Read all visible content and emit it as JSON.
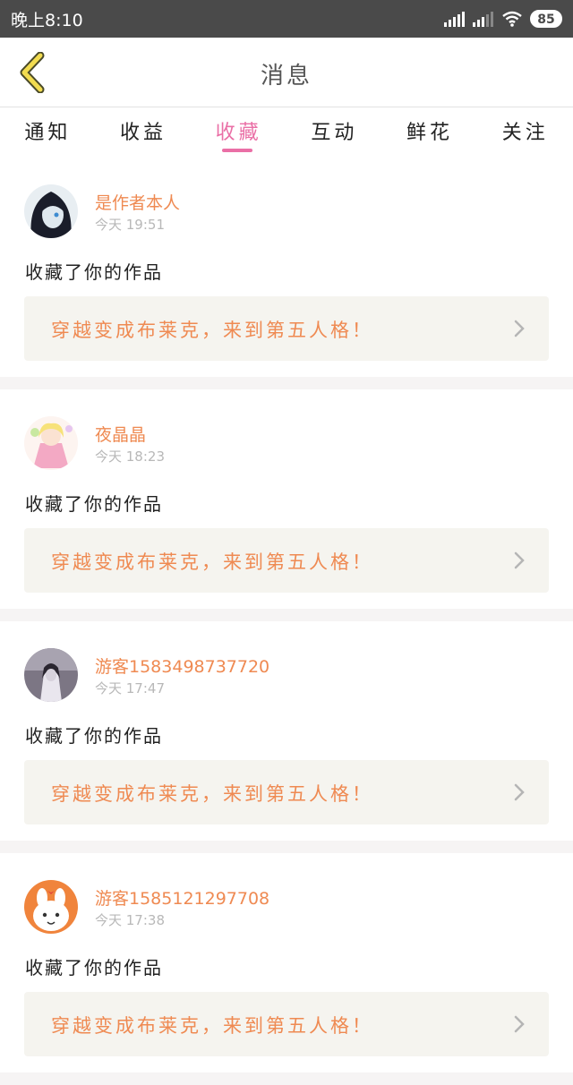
{
  "status": {
    "time": "晚上8:10",
    "battery": "85"
  },
  "header": {
    "title": "消息"
  },
  "tabs": [
    {
      "label": "通知",
      "active": false
    },
    {
      "label": "收益",
      "active": false
    },
    {
      "label": "收藏",
      "active": true
    },
    {
      "label": "互动",
      "active": false
    },
    {
      "label": "鲜花",
      "active": false
    },
    {
      "label": "关注",
      "active": false
    }
  ],
  "colors": {
    "accent": "#ea6fa6",
    "name": "#ef8a52",
    "statusbar": "#4a4a4a"
  },
  "messages": [
    {
      "user": "是作者本人",
      "time": "今天 19:51",
      "action": "收藏了你的作品",
      "work": "穿越变成布莱克，来到第五人格！",
      "avatar": "avatar-dark-hair"
    },
    {
      "user": "夜晶晶",
      "time": "今天 18:23",
      "action": "收藏了你的作品",
      "work": "穿越变成布莱克，来到第五人格！",
      "avatar": "avatar-pink-princess"
    },
    {
      "user": "游客1583498737720",
      "time": "今天 17:47",
      "action": "收藏了你的作品",
      "work": "穿越变成布莱克，来到第五人格！",
      "avatar": "avatar-ghost-girl"
    },
    {
      "user": "游客1585121297708",
      "time": "今天 17:38",
      "action": "收藏了你的作品",
      "work": "穿越变成布莱克，来到第五人格！",
      "avatar": "avatar-bunny"
    }
  ]
}
